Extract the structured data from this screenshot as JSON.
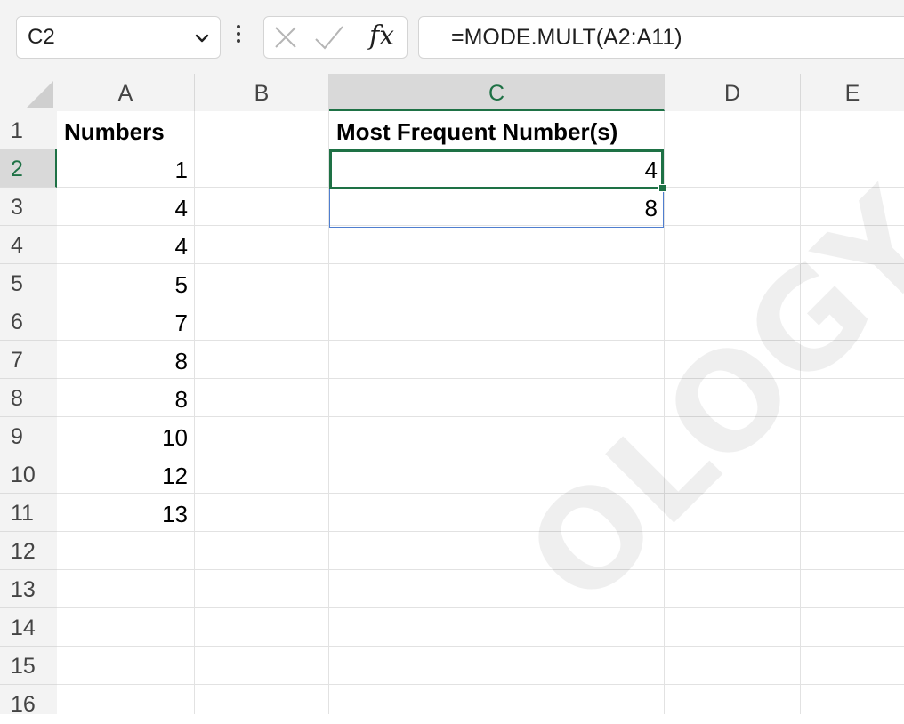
{
  "formula_bar": {
    "name_box": "C2",
    "formula": "=MODE.MULT(A2:A11)",
    "fx_label": "fx"
  },
  "columns": [
    "A",
    "B",
    "C",
    "D",
    "E"
  ],
  "rows": [
    "1",
    "2",
    "3",
    "4",
    "5",
    "6",
    "7",
    "8",
    "9",
    "10",
    "11",
    "12",
    "13",
    "14",
    "15",
    "16"
  ],
  "selection": {
    "column": "C",
    "row": "2"
  },
  "cells": {
    "A1": "Numbers",
    "C1": "Most Frequent Number(s)",
    "A2": "1",
    "A3": "4",
    "A4": "4",
    "A5": "5",
    "A6": "7",
    "A7": "8",
    "A8": "8",
    "A9": "10",
    "A10": "12",
    "A11": "13",
    "C2": "4",
    "C3": "8"
  },
  "colors": {
    "selection_accent": "#1e7145",
    "spill_border": "#4f7ecf"
  },
  "icons": {
    "name_box_dropdown": "chevron-down-icon",
    "more": "more-vertical-icon",
    "cancel": "close-icon",
    "enter": "checkmark-icon"
  }
}
